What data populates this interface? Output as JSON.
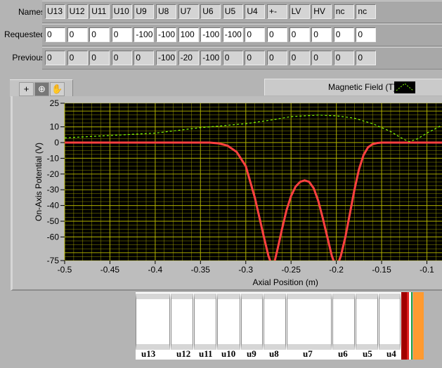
{
  "rows": {
    "names_label": "Names",
    "requested_label": "Requested",
    "previous_label": "Previous",
    "names": [
      "U13",
      "U12",
      "U11",
      "U10",
      "U9",
      "U8",
      "U7",
      "U6",
      "U5",
      "U4",
      "+-",
      "LV",
      "HV",
      "nc",
      "nc"
    ],
    "requested": [
      "0",
      "0",
      "0",
      "0",
      "-100",
      "-100",
      "100",
      "-100",
      "-100",
      "0",
      "0",
      "0",
      "0",
      "0",
      "0"
    ],
    "previous": [
      "0",
      "0",
      "0",
      "0",
      "0",
      "-100",
      "-20",
      "-100",
      "0",
      "0",
      "0",
      "0",
      "0",
      "0",
      "0"
    ]
  },
  "toolbar": {
    "icons": [
      "cursor-crosshair-icon",
      "zoom-icon",
      "pan-hand-icon"
    ]
  },
  "legend": {
    "label": "Magnetic Field (T)"
  },
  "colors": {
    "potential": "#ff4040",
    "field": "#80ff00",
    "grid": "#b8b800",
    "plot_bg": "#000000"
  },
  "chart_data": {
    "type": "line",
    "xlabel": "Axial Position (m)",
    "ylabel": "On-Axis Potential (V)",
    "xlim": [
      -0.5,
      -0.081
    ],
    "ylim": [
      -75,
      25
    ],
    "x_ticks": [
      "-0.5",
      "-0.45",
      "-0.4",
      "-0.35",
      "-0.3",
      "-0.25",
      "-0.2",
      "-0.15",
      "-0.1"
    ],
    "x_tick_values": [
      -0.5,
      -0.45,
      -0.4,
      -0.35,
      -0.3,
      -0.25,
      -0.2,
      -0.15,
      -0.1
    ],
    "y_ticks": [
      "25",
      "10",
      "0",
      "-10",
      "-20",
      "-30",
      "-40",
      "-50",
      "-60",
      "-75"
    ],
    "y_tick_values": [
      25,
      10,
      0,
      -10,
      -20,
      -30,
      -40,
      -50,
      -60,
      -75
    ],
    "grid": true,
    "series": [
      {
        "name": "On-Axis Potential",
        "style": "solid",
        "x": [
          -0.5,
          -0.34,
          -0.33,
          -0.32,
          -0.31,
          -0.3,
          -0.29,
          -0.28,
          -0.275,
          -0.27,
          -0.265,
          -0.26,
          -0.255,
          -0.25,
          -0.245,
          -0.24,
          -0.235,
          -0.23,
          -0.225,
          -0.22,
          -0.215,
          -0.21,
          -0.205,
          -0.2,
          -0.195,
          -0.19,
          -0.185,
          -0.18,
          -0.175,
          -0.17,
          -0.165,
          -0.16,
          -0.155,
          -0.15,
          -0.081
        ],
        "y": [
          0,
          0,
          -0.5,
          -2,
          -6,
          -15,
          -35,
          -60,
          -72,
          -80,
          -68,
          -55,
          -43,
          -34,
          -28,
          -25,
          -24,
          -25,
          -29,
          -37,
          -48,
          -60,
          -72,
          -80,
          -72,
          -60,
          -45,
          -30,
          -17,
          -8,
          -3,
          -1,
          -0.3,
          0,
          0
        ]
      },
      {
        "name": "Magnetic Field (T)",
        "style": "dashed",
        "x": [
          -0.5,
          -0.45,
          -0.4,
          -0.35,
          -0.3,
          -0.27,
          -0.25,
          -0.22,
          -0.2,
          -0.18,
          -0.16,
          -0.14,
          -0.13,
          -0.12,
          -0.11,
          -0.1,
          -0.09,
          -0.081
        ],
        "y": [
          3,
          4.5,
          6,
          9.5,
          12,
          14.5,
          16.5,
          17.5,
          17,
          15.5,
          12,
          7,
          3.5,
          0.5,
          2.5,
          6,
          9,
          12
        ]
      }
    ]
  },
  "diagram": {
    "labels": [
      "u13",
      "u12",
      "u11",
      "u10",
      "u9",
      "u8",
      "u7",
      "u6",
      "u5",
      "u4"
    ]
  }
}
